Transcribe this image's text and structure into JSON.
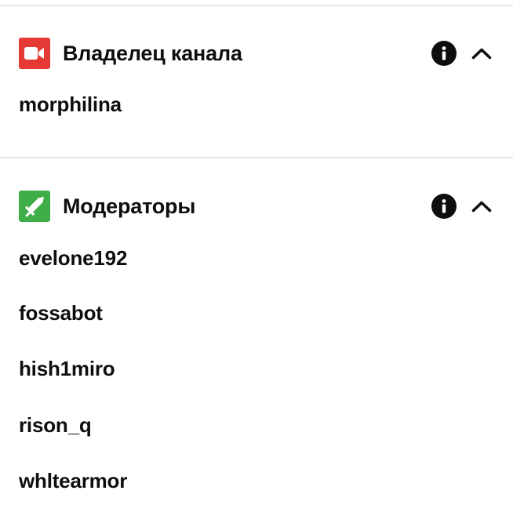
{
  "colors": {
    "owner_badge": "#e53935",
    "moderator_badge": "#3fae49",
    "text": "#0e0e10",
    "divider": "#e5e5e7"
  },
  "owner_section": {
    "title": "Владелец канала",
    "badge_icon": "video-camera-icon",
    "users": [
      "morphilina"
    ]
  },
  "moderators_section": {
    "title": "Модераторы",
    "badge_icon": "sword-icon",
    "users": [
      "evelone192",
      "fossabot",
      "hish1miro",
      "rison_q",
      "whltearmor"
    ]
  }
}
